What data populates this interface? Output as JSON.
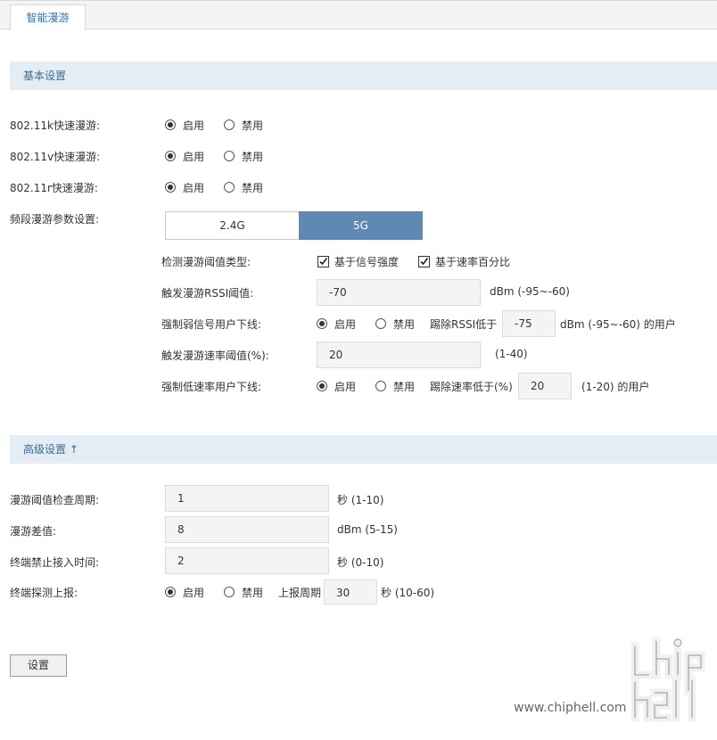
{
  "tabs": [
    {
      "label": "智能漫游"
    }
  ],
  "basic": {
    "title": "基本设置",
    "rows": [
      {
        "label": "802.11k快速漫游:",
        "enable": "启用",
        "disable": "禁用"
      },
      {
        "label": "802.11v快速漫游:",
        "enable": "启用",
        "disable": "禁用"
      },
      {
        "label": "802.11r快速漫游:",
        "enable": "启用",
        "disable": "禁用"
      }
    ],
    "band": {
      "label": "频段漫游参数设置:",
      "options": [
        "2.4G",
        "5G"
      ],
      "selected": "5G"
    },
    "threshold_type": {
      "label": "检测漫游阈值类型:",
      "signal": "基于信号强度",
      "rate": "基于速率百分比"
    },
    "rssi": {
      "label": "触发漫游RSSI阈值:",
      "value": "-70",
      "hint": "dBm (-95~-60)"
    },
    "weak_kick": {
      "label": "强制弱信号用户下线:",
      "enable": "启用",
      "disable": "禁用",
      "prefix": "踢除RSSI低于",
      "value": "-75",
      "suffix": "dBm (-95~-60) 的用户"
    },
    "rate_threshold": {
      "label": "触发漫游速率阈值(%):",
      "value": "20",
      "hint": "(1-40)"
    },
    "low_rate_kick": {
      "label": "强制低速率用户下线:",
      "enable": "启用",
      "disable": "禁用",
      "prefix": "踢除速率低于(%)",
      "value": "20",
      "suffix": "(1-20) 的用户"
    }
  },
  "advanced": {
    "title": "高级设置 ↑",
    "check_period": {
      "label": "漫游阈值检查周期:",
      "value": "1",
      "hint": "秒 (1-10)"
    },
    "diff": {
      "label": "漫游差值:",
      "value": "8",
      "hint": "dBm (5-15)"
    },
    "ban_time": {
      "label": "终端禁止接入时间:",
      "value": "2",
      "hint": "秒 (0-10)"
    },
    "probe_report": {
      "label": "终端探测上报:",
      "enable": "启用",
      "disable": "禁用",
      "period_label": "上报周期",
      "value": "30",
      "hint": "秒 (10-60)"
    }
  },
  "submit_label": "设置",
  "watermark": {
    "text": "www.chiphell.com"
  }
}
